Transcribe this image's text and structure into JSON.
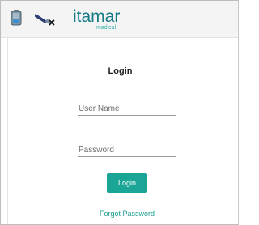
{
  "header": {
    "logo_main": "itamar",
    "logo_sub": "medical"
  },
  "login": {
    "title": "Login",
    "username_placeholder": "User Name",
    "password_placeholder": "Password",
    "submit_label": "Login",
    "forgot_link": "Forgot Password"
  },
  "icons": [
    "battery-icon",
    "probe-icon"
  ],
  "colors": {
    "accent": "#1aa596",
    "brand": "#157a85",
    "brand_light": "#3ab3a8",
    "header_bg": "#f4f4f4"
  }
}
